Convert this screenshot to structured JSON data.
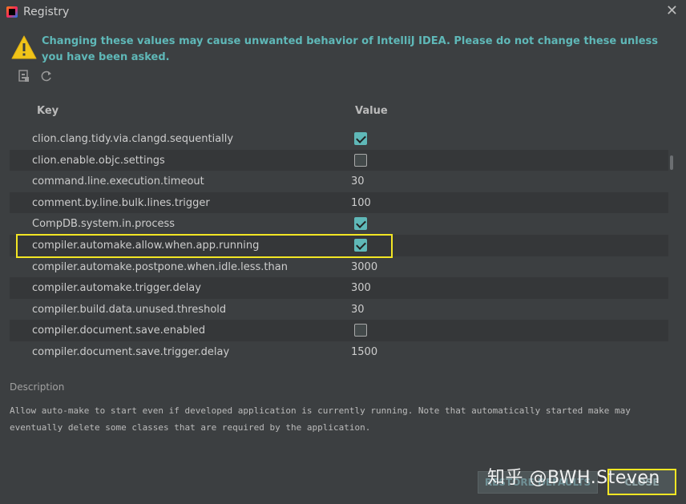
{
  "window": {
    "title": "Registry",
    "close_glyph": "✕"
  },
  "warning": {
    "icon": "warning-icon",
    "text": "Changing these values may cause unwanted behavior of IntelliJ IDEA. Please do not change these unless you have been asked.",
    "color": "#5fb8b8"
  },
  "toolbar": {
    "icons": [
      "restore-file-icon",
      "refresh-icon"
    ]
  },
  "table": {
    "headers": {
      "key": "Key",
      "value": "Value"
    },
    "rows": [
      {
        "key": "clion.clang.tidy.via.clangd.sequentially",
        "type": "checkbox",
        "checked": true,
        "value": ""
      },
      {
        "key": "clion.enable.objc.settings",
        "type": "checkbox",
        "checked": false,
        "value": ""
      },
      {
        "key": "command.line.execution.timeout",
        "type": "text",
        "value": "30"
      },
      {
        "key": "comment.by.line.bulk.lines.trigger",
        "type": "text",
        "value": "100"
      },
      {
        "key": "CompDB.system.in.process",
        "type": "checkbox",
        "checked": true,
        "value": ""
      },
      {
        "key": "compiler.automake.allow.when.app.running",
        "type": "checkbox",
        "checked": true,
        "value": ""
      },
      {
        "key": "compiler.automake.postpone.when.idle.less.than",
        "type": "text",
        "value": "3000"
      },
      {
        "key": "compiler.automake.trigger.delay",
        "type": "text",
        "value": "300"
      },
      {
        "key": "compiler.build.data.unused.threshold",
        "type": "text",
        "value": "30"
      },
      {
        "key": "compiler.document.save.enabled",
        "type": "checkbox",
        "checked": false,
        "value": ""
      },
      {
        "key": "compiler.document.save.trigger.delay",
        "type": "text",
        "value": "1500"
      }
    ],
    "highlighted_row_index": 5
  },
  "description": {
    "label": "Description",
    "text": "Allow auto-make to start even if developed application is currently running. Note that automatically started make may eventually delete some classes that are required by the application."
  },
  "buttons": {
    "restore_defaults": "RESTORE DEFAULTS",
    "close": "CLOSE"
  },
  "watermark": "知乎 @BWH.Steven",
  "colors": {
    "background": "#3c3f41",
    "accent": "#5fb8b8",
    "highlight": "#f3e624"
  }
}
